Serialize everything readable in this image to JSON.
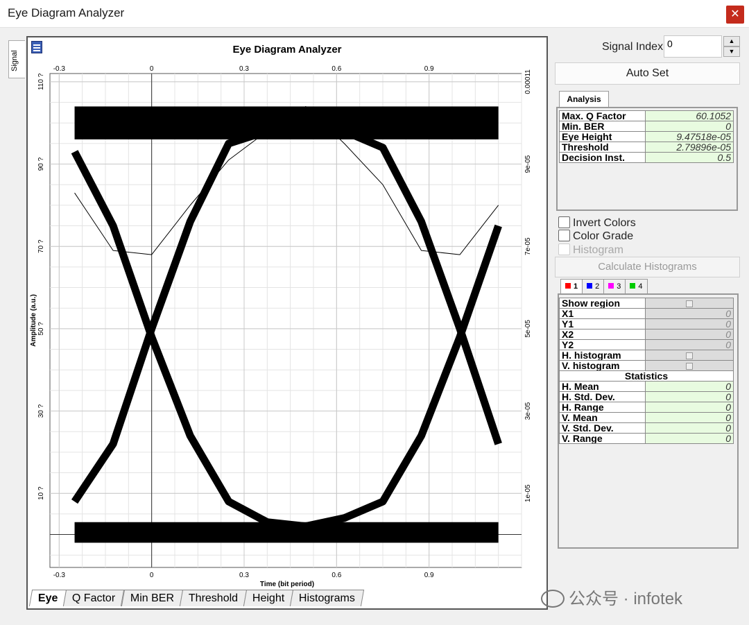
{
  "window": {
    "title": "Eye Diagram Analyzer",
    "close_label": "✕"
  },
  "side_tab": {
    "label": "Signal"
  },
  "chart_data": {
    "type": "line",
    "title": "Eye Diagram Analyzer",
    "xlabel": "Time (bit period)",
    "ylabel": "Amplitude (a.u.)",
    "x_ticks": [
      "-0.3",
      "0",
      "0.3",
      "0.6",
      "0.9"
    ],
    "x_tick_values": [
      -0.3,
      0,
      0.3,
      0.6,
      0.9
    ],
    "y_left_ticks": [
      "110 ?",
      "90 ?",
      "70 ?",
      "50 ?",
      "30 ?",
      "10 ?"
    ],
    "y_left_values": [
      110,
      90,
      70,
      50,
      30,
      10
    ],
    "y_right_ticks": [
      "0.00011",
      "9e-05",
      "7e-05",
      "5e-05",
      "3e-05",
      "1e-05"
    ],
    "xlim": [
      -0.33,
      1.2
    ],
    "ylim": [
      -8,
      112
    ],
    "grid": true,
    "eye": {
      "x": [
        -0.25,
        -0.125,
        0,
        0.125,
        0.25,
        0.375,
        0.5,
        0.625,
        0.75,
        0.875,
        1.0,
        1.125
      ],
      "upper": [
        100.5,
        100.5,
        100.5,
        100.5,
        100.5,
        100.5,
        100.5,
        100.5,
        100.5,
        100.5,
        100.5,
        100.5
      ],
      "lower": [
        0.5,
        0.5,
        0.5,
        0.5,
        0.5,
        0.5,
        0.5,
        0.5,
        0.5,
        0.5,
        0.5,
        0.5
      ],
      "rising_top": [
        8,
        22,
        50,
        76,
        95,
        98,
        100
      ],
      "rising_top_x": [
        -0.25,
        -0.125,
        0,
        0.125,
        0.25,
        0.375,
        0.5
      ],
      "falling_bottom": [
        93,
        75,
        48,
        24,
        8,
        3,
        2
      ],
      "falling_bottom_x": [
        -0.25,
        -0.125,
        0,
        0.125,
        0.25,
        0.375,
        0.5
      ],
      "bottom_arc": [
        8,
        3,
        2,
        4,
        8,
        24,
        48,
        75,
        94
      ],
      "bottom_arc_x": [
        0.25,
        0.375,
        0.5,
        0.625,
        0.75,
        0.875,
        1.0,
        1.125,
        1.125
      ],
      "outlier_x": [
        -0.25,
        -0.125,
        0,
        0.125,
        0.25,
        0.375,
        0.5,
        0.625,
        0.75,
        0.875,
        1.0,
        1.125
      ],
      "outlier_y": [
        83,
        69,
        68,
        80,
        91,
        98,
        104,
        95,
        85,
        69,
        68,
        80
      ]
    }
  },
  "bottom_tabs": [
    "Eye",
    "Q Factor",
    "Min BER",
    "Threshold",
    "Height",
    "Histograms"
  ],
  "signal_index": {
    "label": "Signal Index:",
    "value": "0"
  },
  "auto_set_label": "Auto Set",
  "analysis_tab": "Analysis",
  "analysis": [
    {
      "key": "Max. Q Factor",
      "value": "60.1052"
    },
    {
      "key": "Min. BER",
      "value": "0"
    },
    {
      "key": "Eye Height",
      "value": "9.47518e-05"
    },
    {
      "key": "Threshold",
      "value": "2.79896e-05"
    },
    {
      "key": "Decision Inst.",
      "value": "0.5"
    }
  ],
  "checkboxes": [
    {
      "label": "Invert Colors",
      "disabled": false
    },
    {
      "label": "Color Grade",
      "disabled": false
    },
    {
      "label": "Histogram",
      "disabled": true
    }
  ],
  "calc_hist_label": "Calculate Histograms",
  "color_tabs": [
    {
      "label": "1",
      "color": "#ff0000"
    },
    {
      "label": "2",
      "color": "#0000ff"
    },
    {
      "label": "3",
      "color": "#ff00ff"
    },
    {
      "label": "4",
      "color": "#00cc00"
    }
  ],
  "region": [
    {
      "key": "Show region",
      "value": ""
    },
    {
      "key": "X1",
      "value": "0"
    },
    {
      "key": "Y1",
      "value": "0"
    },
    {
      "key": "X2",
      "value": "0"
    },
    {
      "key": "Y2",
      "value": "0"
    },
    {
      "key": "H. histogram",
      "value": ""
    },
    {
      "key": "V. histogram",
      "value": ""
    }
  ],
  "statistics_header": "Statistics",
  "statistics": [
    {
      "key": "H. Mean",
      "value": "0"
    },
    {
      "key": "H. Std. Dev.",
      "value": "0"
    },
    {
      "key": "H. Range",
      "value": "0"
    },
    {
      "key": "V. Mean",
      "value": "0"
    },
    {
      "key": "V. Std. Dev.",
      "value": "0"
    },
    {
      "key": "V. Range",
      "value": "0"
    }
  ],
  "watermark": "公众号 · infotek"
}
